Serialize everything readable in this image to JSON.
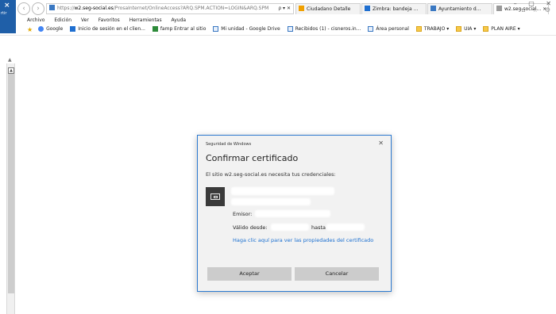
{
  "left_strip": {
    "close_glyph": "×",
    "text": "rtir"
  },
  "browser": {
    "nav": {
      "back": "‹",
      "forward": "›"
    },
    "address": {
      "scheme": "https://",
      "domain": "w2.seg-social.es",
      "path": "/ProsaInternet/OnlineAccess?ARQ.SPM.ACTION=LOGIN&ARQ.SPM",
      "tail": "ρ ▾ ✕"
    },
    "tabs": [
      {
        "label": "Ciudadano Detalle",
        "icon_color": "#f0a000",
        "active": false
      },
      {
        "label": "Zimbra: bandeja ...",
        "icon_color": "#1f6fd0",
        "active": false
      },
      {
        "label": "Ayuntamiento d...",
        "icon_color": "#3a78c2",
        "active": false
      },
      {
        "label": "w2.seg-social... ×",
        "icon_color": "#999999",
        "active": true
      }
    ],
    "window_controls": {
      "minimize": "–",
      "maximize": "▢",
      "close": "✕"
    },
    "right_icons": "⌂ ☆ ⚙",
    "menu": [
      "Archivo",
      "Edición",
      "Ver",
      "Favoritos",
      "Herramientas",
      "Ayuda"
    ],
    "favorites": [
      {
        "label": "Google",
        "icon": "google-icon"
      },
      {
        "label": "Inicio de sesión en el clien...",
        "icon": "zimbra-icon"
      },
      {
        "label": "famp Entrar al sitio",
        "icon": "famp-icon"
      },
      {
        "label": "Mi unidad - Google Drive",
        "icon": "ie-page-icon"
      },
      {
        "label": "Recibidos (1) - cisneros.in...",
        "icon": "ie-page-icon"
      },
      {
        "label": "Área personal",
        "icon": "ie-page-icon"
      },
      {
        "label": "TRABAJO ▾",
        "icon": "folder-icon"
      },
      {
        "label": "UIA ▾",
        "icon": "folder-icon"
      },
      {
        "label": "PLAN AIRE ▾",
        "icon": "folder-icon"
      }
    ]
  },
  "dialog": {
    "window_title": "Seguridad de Windows",
    "close_glyph": "✕",
    "heading": "Confirmar certificado",
    "message": "El sitio w2.seg-social.es necesita tus credenciales:",
    "issuer_label": "Emisor:",
    "valid_from_label": "Válido desde:",
    "valid_until_label": "hasta",
    "properties_link": "Haga clic aquí para ver las propiedades del certificado",
    "accept_button": "Aceptar",
    "cancel_button": "Cancelar"
  },
  "colors": {
    "dialog_border": "#2b79d0",
    "link": "#1a6fd0",
    "button_bg": "#cccccc"
  }
}
